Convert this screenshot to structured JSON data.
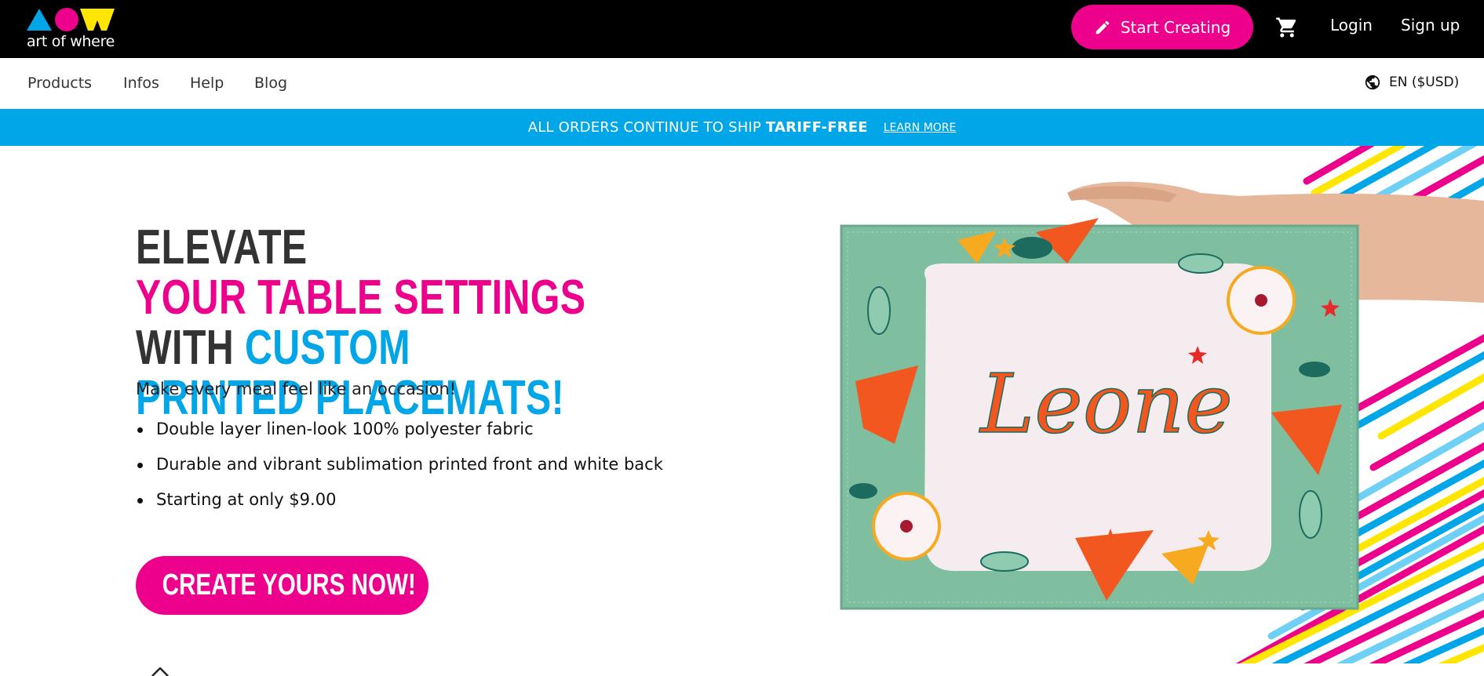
{
  "header": {
    "logo_text": "art of where",
    "start_creating_label": "Start Creating",
    "cart_icon": "cart-icon",
    "login_label": "Login",
    "signup_label": "Sign up"
  },
  "nav": {
    "items": [
      "Products",
      "Infos",
      "Help",
      "Blog"
    ],
    "language_label": "EN ($USD)"
  },
  "banner": {
    "text_prefix": "ALL ORDERS CONTINUE TO SHIP",
    "text_bold": "TARIFF-FREE",
    "link_label": "LEARN MORE"
  },
  "hero": {
    "title_part1": "Elevate",
    "title_part2": "your table settings",
    "title_part3": "with",
    "title_part4": "custom",
    "title_part5": "printed placemats!",
    "subtitle": "Make every meal feel like an occasion!",
    "bullets": [
      "Double layer linen-look 100% polyester fabric",
      "Durable and vibrant sublimation printed front and white back",
      "Starting at only $9.00"
    ],
    "cta_label": "Create yours now!",
    "placemat_text": "Leone"
  },
  "colors": {
    "brand_pink": "#ec008c",
    "brand_blue": "#00a6e8",
    "brand_yellow": "#ffe600",
    "dark": "#333333",
    "placemat_green": "#7fbfa0"
  }
}
